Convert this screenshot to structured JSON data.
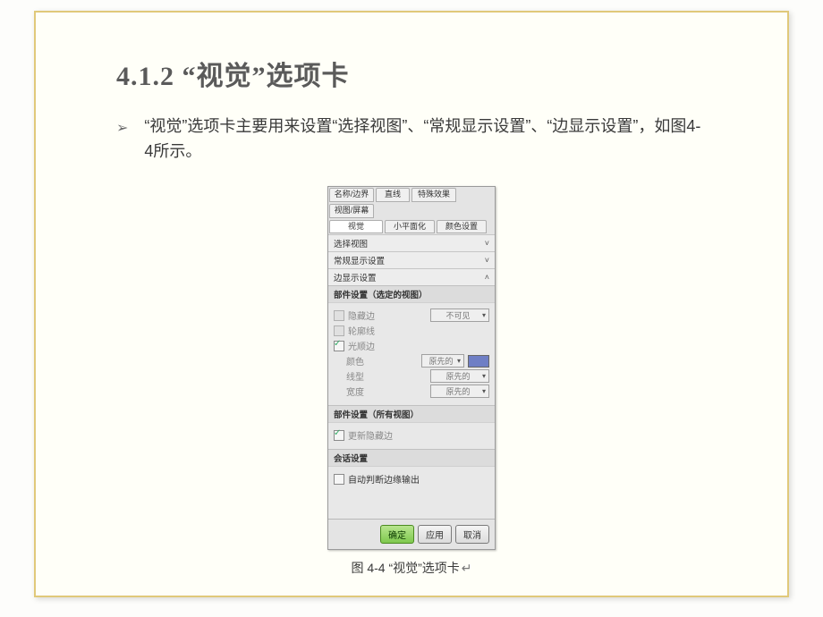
{
  "heading": "4.1.2   “视觉”选项卡",
  "bullet": "“视觉”选项卡主要用来设置“选择视图”、“常规显示设置”、“边显示设置”，如图4-4所示。",
  "dialog": {
    "tabs_row1": [
      "名称/边界",
      "直线",
      "特殊效果",
      "视图/屏幕"
    ],
    "tabs_row2": [
      "视觉",
      "小平面化",
      "颜色设置"
    ],
    "accordions": {
      "a1": "选择视图",
      "a2": "常规显示设置",
      "a3": "边显示设置"
    },
    "group1_title": "部件设置（选定的视图）",
    "g1": {
      "hidden_edge": "隐藏边",
      "hidden_edge_value": "不可见",
      "contour": "轮廓线",
      "smooth": "光顺边",
      "color": "颜色",
      "linetype": "线型",
      "width": "宽度",
      "original": "原先的"
    },
    "group2_title": "部件设置（所有视图）",
    "g2": {
      "update_hidden_edges": "更新隐藏边"
    },
    "group3_title": "会话设置",
    "g3": {
      "auto_update": "自动判断边缘输出"
    },
    "buttons": {
      "ok": "确定",
      "apply": "应用",
      "cancel": "取消"
    }
  },
  "caption": "图 4-4  “视觉”选项卡"
}
